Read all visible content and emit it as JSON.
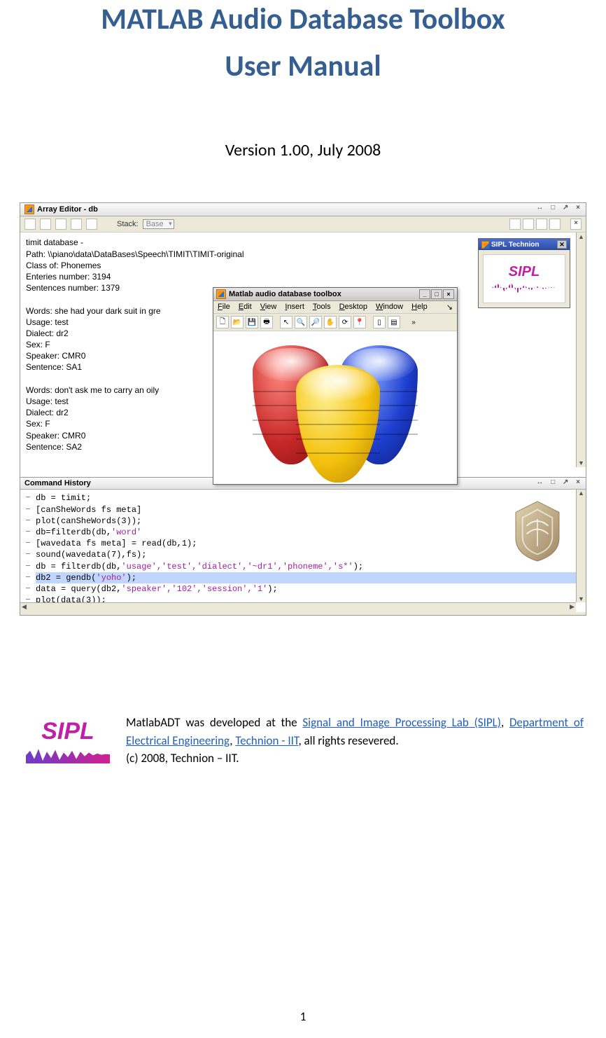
{
  "title_line1": "MATLAB Audio Database Toolbox",
  "title_line2": "User Manual",
  "version": "Version 1.00, July 2008",
  "page_number": "1",
  "array_editor": {
    "title": "Array Editor - db",
    "stack_label": "Stack:",
    "stack_value": "Base",
    "lines": [
      "timit database -",
      "Path: \\\\piano\\data\\DataBases\\Speech\\TIMIT\\TIMIT-original",
      "Class of: Phonemes",
      "Enteries number: 3194",
      "Sentences number: 1379",
      "",
      "Words: she had your dark suit in gre",
      "Usage: test",
      "Dialect: dr2",
      "Sex: F",
      "Speaker: CMR0",
      "Sentence: SA1",
      "",
      "Words: don't ask me to carry an oily",
      "Usage: test",
      "Dialect: dr2",
      "Sex: F",
      "Speaker: CMR0",
      "Sentence: SA2"
    ]
  },
  "sipl_window_title": "SIPL Technion",
  "sipl_label": "SIPL",
  "figure_window": {
    "title": "Matlab audio database toolbox",
    "menus": [
      "File",
      "Edit",
      "View",
      "Insert",
      "Tools",
      "Desktop",
      "Window",
      "Help"
    ]
  },
  "command_history": {
    "title": "Command History",
    "lines": [
      {
        "t": "db = timit;"
      },
      {
        "t": "[canSheWords fs meta]"
      },
      {
        "t": "plot(canSheWords(3));"
      },
      {
        "t": "db=filterdb(db,",
        "s": "'word'"
      },
      {
        "t": "[wavedata fs meta] = read(db,1);"
      },
      {
        "t": "sound(wavedata(7),fs);"
      },
      {
        "t": "db = filterdb(db,",
        "s": "'usage','test','dialect','~dr1','phoneme','s*'",
        "t2": ");"
      },
      {
        "t": "db2 = gendb(",
        "s": "'yoho'",
        "t2": ");",
        "sel": true
      },
      {
        "t": "data = query(db2,",
        "s": "'speaker','102','session','1'",
        "t2": ");"
      },
      {
        "t": "plot(data(3));"
      }
    ]
  },
  "footer": {
    "text_prefix": "MatlabADT was developed at the ",
    "link1": "Signal and Image Processing Lab (SIPL)",
    "sep1": ", ",
    "link2": "Department of Electrical Engineering",
    "sep2": ", ",
    "link3": "Technion - IIT",
    "text_suffix": ", all rights resevered.",
    "copyright": "(c) 2008, Technion – IIT."
  }
}
